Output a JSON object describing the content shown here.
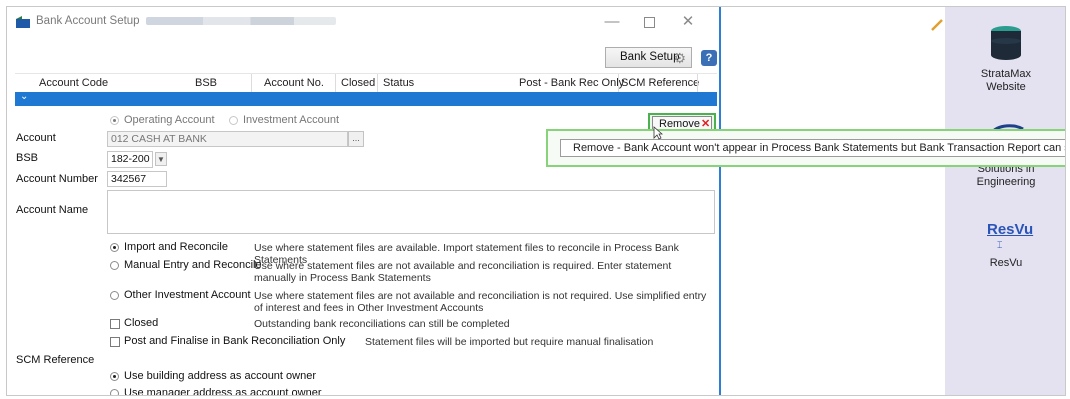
{
  "window": {
    "title": "Bank Account Setup",
    "minimize": "—",
    "close": "✕"
  },
  "toolbar": {
    "bank_setup_label": "Bank Setup",
    "help_label": "?"
  },
  "grid": {
    "columns": [
      "Account Code",
      "BSB",
      "Account No.",
      "Closed",
      "Status",
      "Post - Bank Rec Only",
      "SCM Reference"
    ]
  },
  "form": {
    "operating_account": "Operating Account",
    "investment_account": "Investment Account",
    "remove_label": "Remove",
    "account_label": "Account",
    "account_value": "012 CASH AT BANK",
    "browse_label": "...",
    "bsb_label": "BSB",
    "bsb_value": "182-200",
    "account_number_label": "Account Number",
    "account_number_value": "342567",
    "account_name_label": "Account Name",
    "account_name_value": "",
    "options": [
      {
        "label": "Import and Reconcile",
        "desc": "Use where statement files are available.  Import statement files to reconcile in Process Bank Statements"
      },
      {
        "label": "Manual Entry and Reconcile",
        "desc": "Use where statement files are not available and reconciliation is required.  Enter statement manually in Process Bank Statements"
      },
      {
        "label": "Other Investment Account",
        "desc": "Use where statement files are not available and reconciliation is not required.  Use simplified entry of interest and fees in Other Investment Accounts"
      }
    ],
    "closed_label": "Closed",
    "closed_desc": "Outstanding bank reconciliations can still be completed",
    "post_finalise_label": "Post and Finalise in Bank Reconciliation Only",
    "post_finalise_desc": "Statement files will be imported but require manual finalisation",
    "scm_reference_label": "SCM Reference",
    "scm_building": "Use building address as account owner",
    "scm_manager": "Use manager address as account owner"
  },
  "tooltip": {
    "text": "Remove - Bank Account won't appear in Process Bank Statements but Bank Transaction Report can still be printe"
  },
  "sidebar": {
    "items": [
      {
        "label_line1": "StrataMax",
        "label_line2": "Website"
      },
      {
        "label_line1": "Solutions in",
        "label_line2": "Engineering"
      },
      {
        "logo_text": "ResVu",
        "label": "ResVu"
      }
    ]
  },
  "colors": {
    "accent_blue": "#1f78d1",
    "highlight_green": "#4caf50",
    "remove_red": "#e02020",
    "sidebar_bg": "#e4e1f0"
  }
}
